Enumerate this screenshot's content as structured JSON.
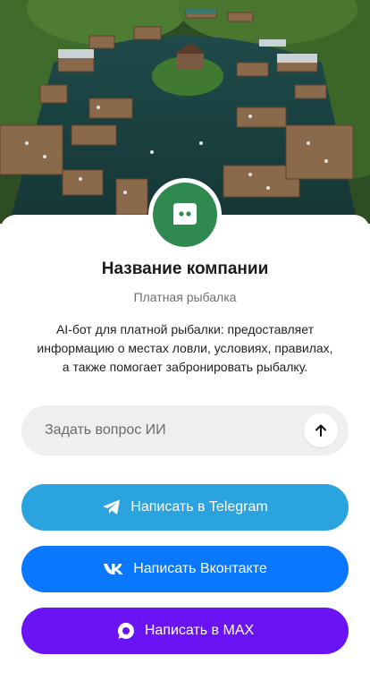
{
  "company": {
    "name": "Название компании",
    "category": "Платная рыбалка",
    "description": "AI-бот для платной рыбалки: предоставляет информацию о местах ловли, условиях, правилах, а также помогает забронировать рыбалку."
  },
  "ask": {
    "placeholder": "Задать вопрос ИИ"
  },
  "buttons": {
    "telegram": "Написать в Telegram",
    "vk": "Написать Вконтакте",
    "max": "Написать в MAX"
  },
  "colors": {
    "avatar": "#2f8a4f",
    "telegram": "#2aa3df",
    "vk": "#0a77ff",
    "max": "#6a14f5"
  }
}
